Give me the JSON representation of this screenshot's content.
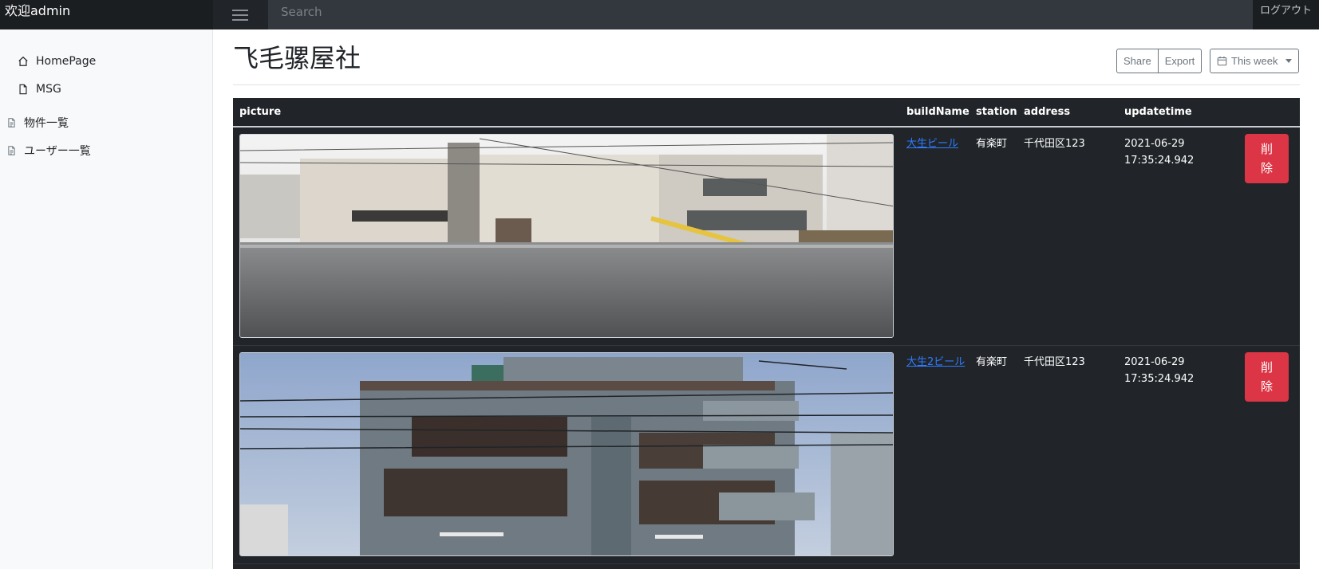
{
  "navbar": {
    "brand": "欢迎admin",
    "search_placeholder": "Search",
    "logout_label": "ログアウト"
  },
  "sidebar": {
    "items": [
      {
        "label": "HomePage",
        "icon": "home-icon"
      },
      {
        "label": "MSG",
        "icon": "file-icon"
      },
      {
        "label": "物件一覧",
        "icon": "file-text-icon"
      },
      {
        "label": "ユーザー一覧",
        "icon": "file-text-icon"
      }
    ]
  },
  "main": {
    "title": "飞毛骡屋社",
    "share_label": "Share",
    "export_label": "Export",
    "week_label": "This week"
  },
  "table": {
    "headers": [
      "picture",
      "buildName",
      "station",
      "address",
      "updatetime"
    ],
    "rows": [
      {
        "buildName": "大生ビール",
        "station": "有楽町",
        "address": "千代田区123",
        "date": "2021-06-29",
        "time": "17:35:24.942",
        "delete_label": "削除"
      },
      {
        "buildName": "大生2ビール",
        "station": "有楽町",
        "address": "千代田区123",
        "date": "2021-06-29",
        "time": "17:35:24.942",
        "delete_label": "削除"
      }
    ]
  },
  "colors": {
    "navbar": "#212529",
    "danger": "#dc3545",
    "link": "#2e7bff"
  }
}
